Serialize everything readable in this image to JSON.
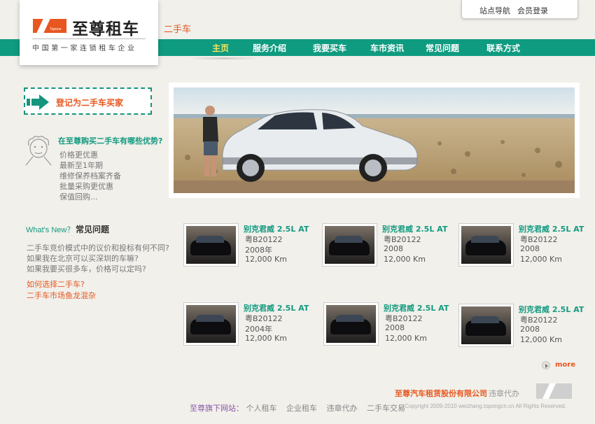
{
  "brand": {
    "logo_text": "至尊租车",
    "logo_sub": "Topone",
    "tagline": "中国第一家连锁租车企业"
  },
  "section_title": "二手车",
  "top_links": [
    "站点导航",
    "会员登录"
  ],
  "nav": {
    "items": [
      "主页",
      "服务介绍",
      "我要买车",
      "车市资讯",
      "常见问题",
      "联系方式"
    ],
    "active_index": 0
  },
  "register": {
    "label": "登记为二手车买家"
  },
  "advantages": {
    "title": "在至尊购买二手车有哪些优势?",
    "items": [
      "价格更优惠",
      "最新至1年期",
      "维修保养档案齐备",
      "批量采购更优惠",
      "保值回购..."
    ]
  },
  "faq": {
    "whats_new": "What's New？",
    "title": "常见问题",
    "items": [
      "二手车竞价模式中的议价和投标有何不同?",
      "如果我在北京可以买深圳的车嘛?",
      "如果我要买很多车，价格可以定吗?"
    ],
    "links": [
      "如何选择二手车?",
      "二手车市场鱼龙混杂"
    ]
  },
  "cars": [
    {
      "name": "别克君威 2.5L AT",
      "plate": "粤B20122",
      "year": "2008年",
      "km": "12,000 Km"
    },
    {
      "name": "别克君威 2.5L AT",
      "plate": "粤B20122",
      "year": "2008",
      "km": "12,000 Km"
    },
    {
      "name": "别克君威 2.5L AT",
      "plate": "粤B20122",
      "year": "2008",
      "km": "12,000 Km"
    },
    {
      "name": "别克君威 2.5L AT",
      "plate": "粤B20122",
      "year": "2004年",
      "km": "12,000 Km"
    },
    {
      "name": "别克君威 2.5L AT",
      "plate": "粤B20122",
      "year": "2008",
      "km": "12,000 Km"
    },
    {
      "name": "别克君威 2.5L AT",
      "plate": "粤B20122",
      "year": "2008",
      "km": "12,000 Km"
    }
  ],
  "more_label": "more",
  "footer": {
    "company": "至尊汽车租赁股份有限公司",
    "company_sub": "违章代办",
    "copyright": "Copyright 2009-2010 weizhang.topongcn.cn  All Rights Reserved.",
    "sites_label": "至尊旗下网站：",
    "sites": [
      "个人租车",
      "企业租车",
      "违章代办",
      "二手车交易"
    ]
  }
}
